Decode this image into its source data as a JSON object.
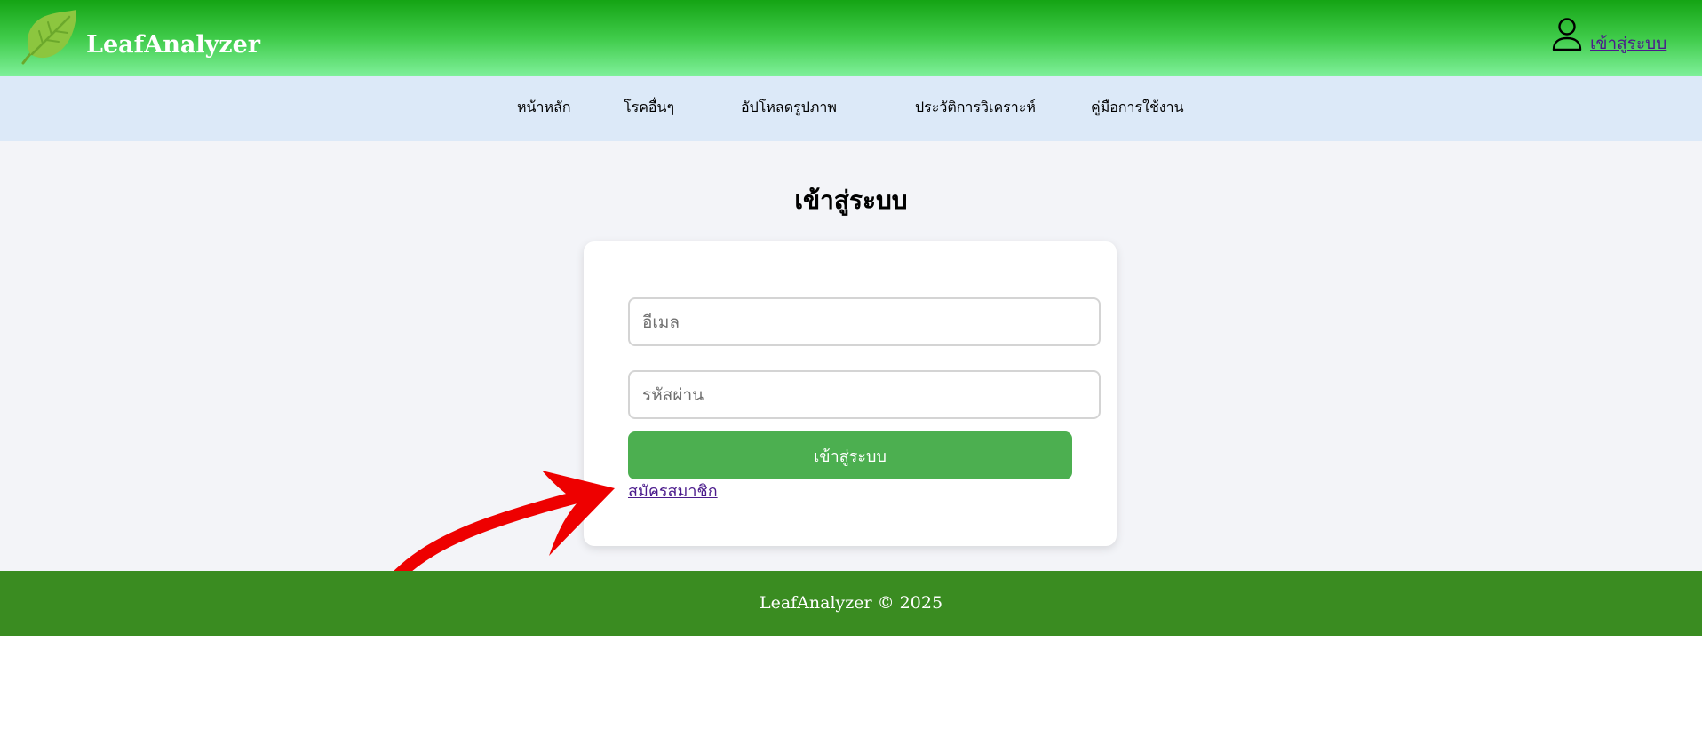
{
  "header": {
    "brand": "LeafAnalyzer",
    "login_link": "เข้าสู่ระบบ",
    "logo_icon": "leaf-icon",
    "user_icon": "user-icon"
  },
  "nav": {
    "items": [
      {
        "label": "หน้าหลัก"
      },
      {
        "label": "โรคอื่นๆ"
      },
      {
        "label": "อัปโหลดรูปภาพ"
      },
      {
        "label": "ประวัติการวิเคราะห์"
      },
      {
        "label": "คู่มือการใช้งาน"
      }
    ]
  },
  "login_form": {
    "title": "เข้าสู่ระบบ",
    "email_placeholder": "อีเมล",
    "email_value": "",
    "password_placeholder": "รหัสผ่าน",
    "password_value": "",
    "submit_label": "เข้าสู่ระบบ",
    "register_link": "สมัครสมาชิก"
  },
  "annotation": {
    "arrow_color": "#ee0000"
  },
  "footer": {
    "text": "LeafAnalyzer © 2025"
  },
  "colors": {
    "header_top": "#14a414",
    "header_bottom": "#7ff09a",
    "nav_background": "#dce9f8",
    "button": "#4caf50",
    "footer": "#3a8c21",
    "link": "#4b1b8c"
  }
}
